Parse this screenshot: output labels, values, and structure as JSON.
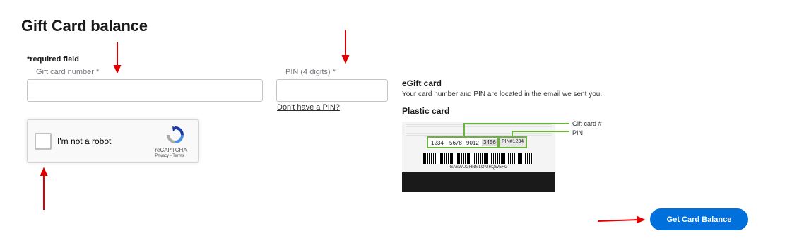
{
  "page": {
    "title": "Gift Card balance",
    "required_note": "*required field"
  },
  "form": {
    "card_number": {
      "label": "Gift card number *",
      "value": "",
      "placeholder": ""
    },
    "pin": {
      "label": "PIN (4 digits) *",
      "value": "",
      "placeholder": ""
    },
    "no_pin_link": "Don't have a PIN?",
    "submit_label": "Get Card Balance"
  },
  "recaptcha": {
    "label": "I'm not a robot",
    "brand": "reCAPTCHA",
    "links": "Privacy - Terms"
  },
  "info": {
    "egift_title": "eGift card",
    "egift_desc": "Your card number and PIN are located in the email we sent you.",
    "plastic_title": "Plastic card",
    "card": {
      "number_groups": [
        "1234",
        "5678",
        "9012",
        "3456"
      ],
      "pin_text": "PIN#1234",
      "barcode_text": "GASWUGHNMLOIUHQWEFG"
    },
    "callouts": {
      "gift_card": "Gift card #",
      "pin": "PIN"
    }
  },
  "annotations": {
    "arrow_color": "#e00000"
  },
  "colors": {
    "primary_button": "#0071dc",
    "callout_green": "#6cb33e"
  }
}
